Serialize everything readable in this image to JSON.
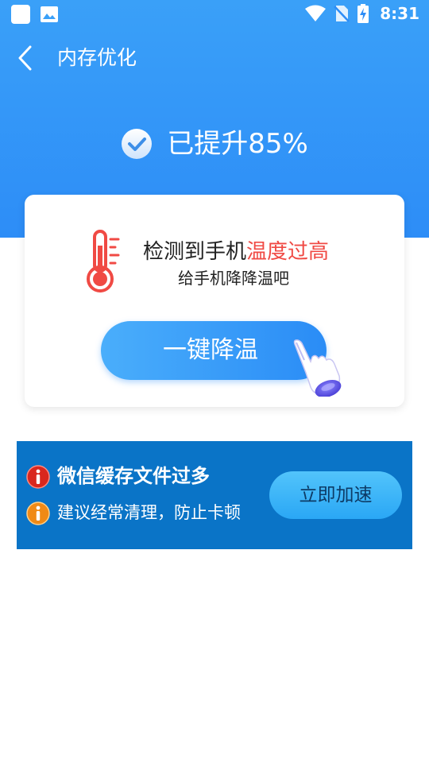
{
  "status_bar": {
    "time": "8:31",
    "icons": [
      "notification-square-icon",
      "image-icon",
      "wifi-icon",
      "no-sim-icon",
      "battery-charging-icon"
    ]
  },
  "app_bar": {
    "title": "内存优化",
    "back_icon": "chevron-left-icon"
  },
  "result": {
    "text": "已提升85%",
    "icon": "check-circle-icon"
  },
  "temperature_card": {
    "warning_prefix": "检测到手机",
    "warning_highlight": "温度过高",
    "subtitle": "给手机降降温吧",
    "button_label": "一键降温",
    "icons": [
      "thermometer-icon",
      "pointing-hand-icon"
    ],
    "highlight_color": "#f04a44"
  },
  "banner": {
    "line1": "微信缓存文件过多",
    "line2": "建议经常清理，防止卡顿",
    "button_label": "立即加速",
    "icons": [
      "red-info-icon",
      "orange-info-icon"
    ],
    "background_color": "#0a74c7"
  },
  "colors": {
    "primary": "#2d8df7",
    "accent_red": "#f04a44"
  }
}
